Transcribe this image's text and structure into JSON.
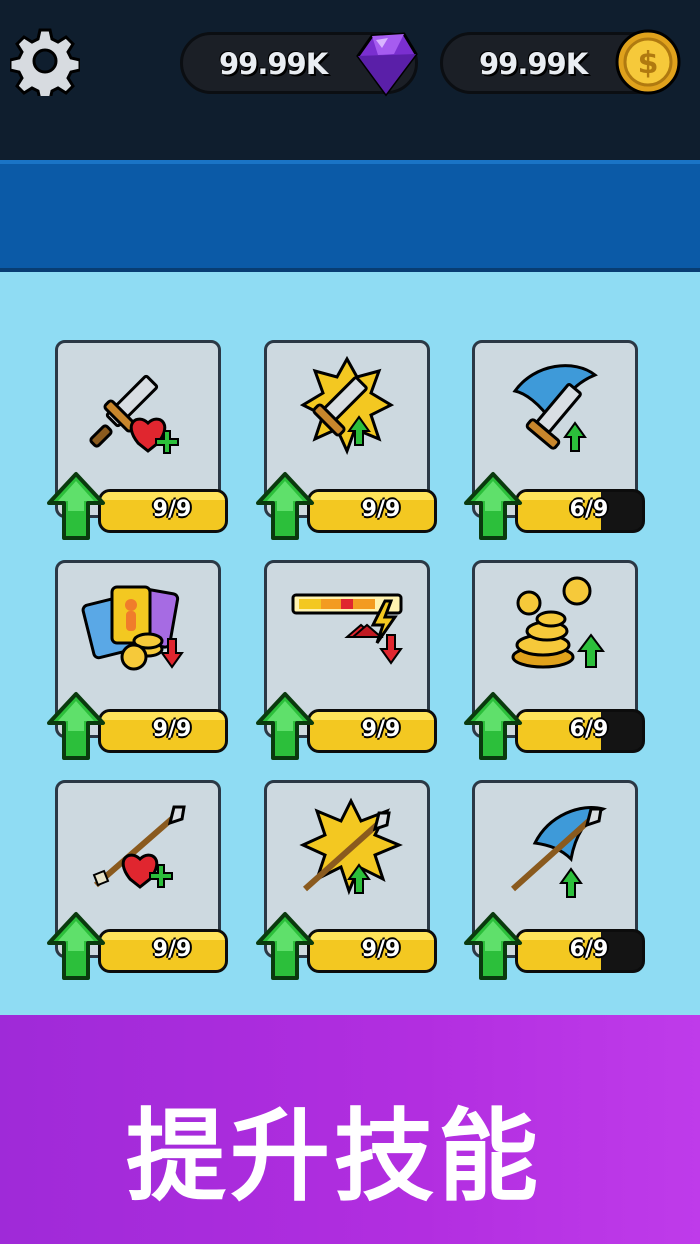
{
  "currency": {
    "gems": "99.99K",
    "coins": "99.99K",
    "gem_icon": "purple-gem-icon",
    "coin_icon": "gold-coin-icon"
  },
  "skills": [
    {
      "icon": "sword-heart-icon",
      "level": "9/9",
      "progress": 1.0
    },
    {
      "icon": "sword-burst-icon",
      "level": "9/9",
      "progress": 1.0
    },
    {
      "icon": "axe-upgrade-icon",
      "level": "6/9",
      "progress": 0.667
    },
    {
      "icon": "cards-coins-icon",
      "level": "9/9",
      "progress": 1.0
    },
    {
      "icon": "energy-bar-icon",
      "level": "9/9",
      "progress": 1.0
    },
    {
      "icon": "coin-pile-icon",
      "level": "6/9",
      "progress": 0.667
    },
    {
      "icon": "arrow-heart-icon",
      "level": "9/9",
      "progress": 1.0
    },
    {
      "icon": "arrow-burst-icon",
      "level": "9/9",
      "progress": 1.0
    },
    {
      "icon": "arrow-blue-upgrade-icon",
      "level": "6/9",
      "progress": 0.667
    }
  ],
  "banner": {
    "text": "提升技能"
  },
  "colors": {
    "fill": "#f3c821",
    "up_arrow": "#2cbf3b",
    "banner": "#b22ee0"
  }
}
